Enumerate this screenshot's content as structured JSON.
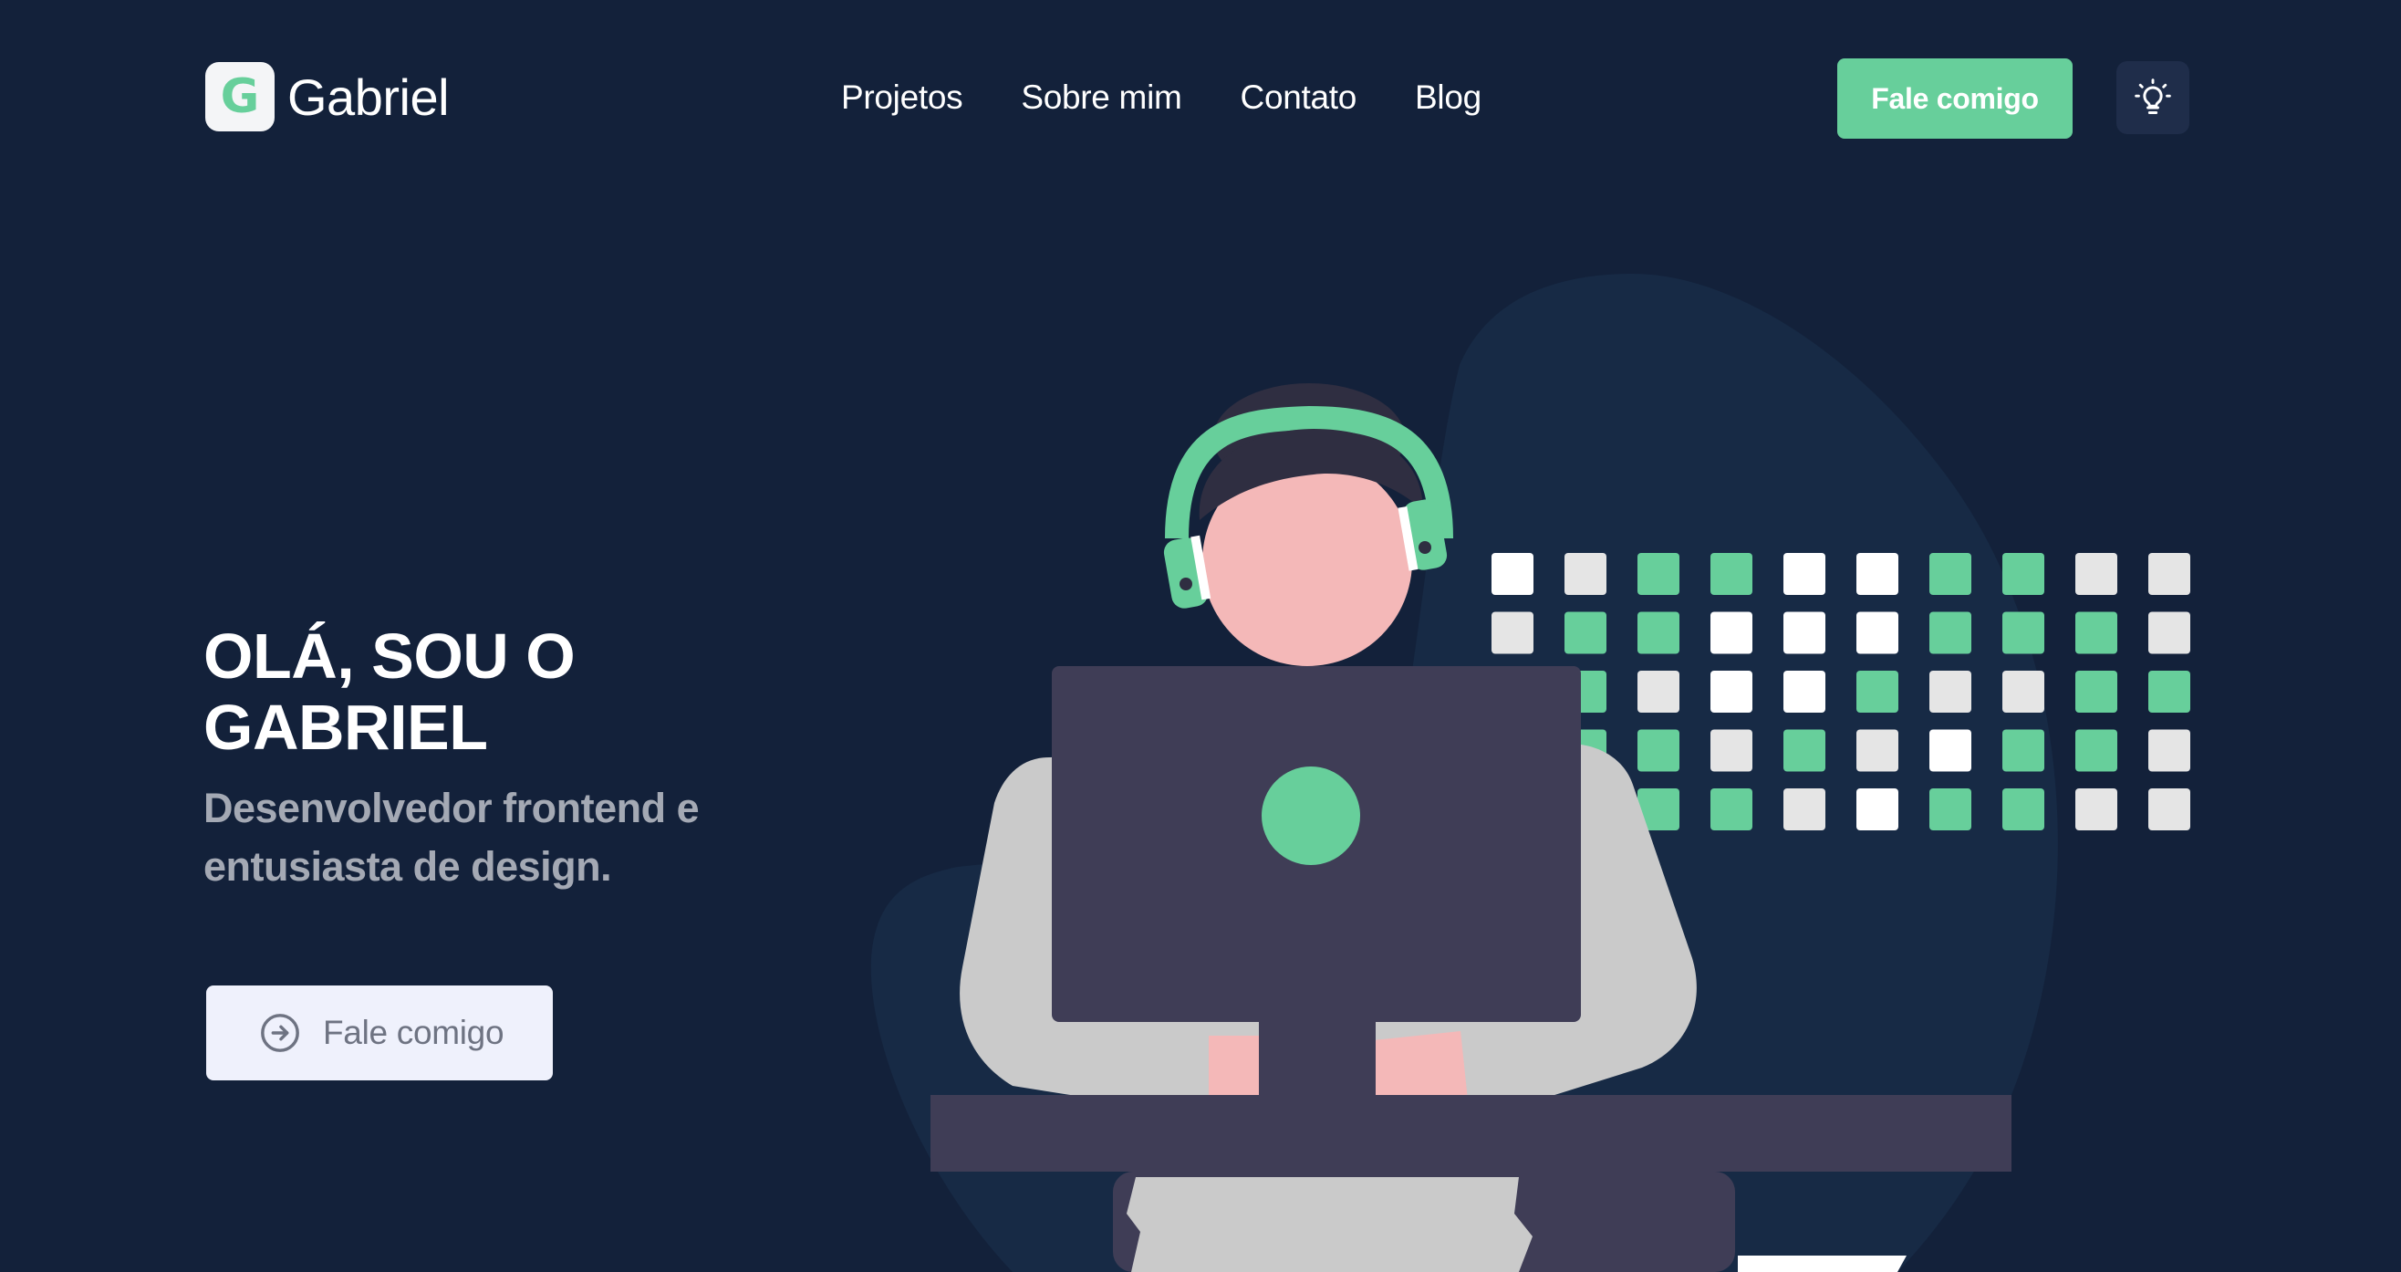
{
  "header": {
    "logo_letter": "G",
    "logo_text": "Gabriel",
    "nav": [
      {
        "label": "Projetos"
      },
      {
        "label": "Sobre mim"
      },
      {
        "label": "Contato"
      },
      {
        "label": "Blog"
      }
    ],
    "cta_label": "Fale comigo",
    "theme_toggle_icon": "lightbulb-icon"
  },
  "hero": {
    "title_line1": "OLÁ, SOU O",
    "title_line2": "GABRIEL",
    "subtitle_line1": "Desenvolvedor frontend e",
    "subtitle_line2": "entusiasta de design.",
    "cta_label": "Fale comigo",
    "cta_icon": "arrow-circle-right-icon"
  },
  "colors": {
    "background": "#13213a",
    "accent": "#67cf9b",
    "blob": "#172a45",
    "monitor": "#3f3d56",
    "skin": "#f4b8b8",
    "shirt": "#cacaca"
  }
}
